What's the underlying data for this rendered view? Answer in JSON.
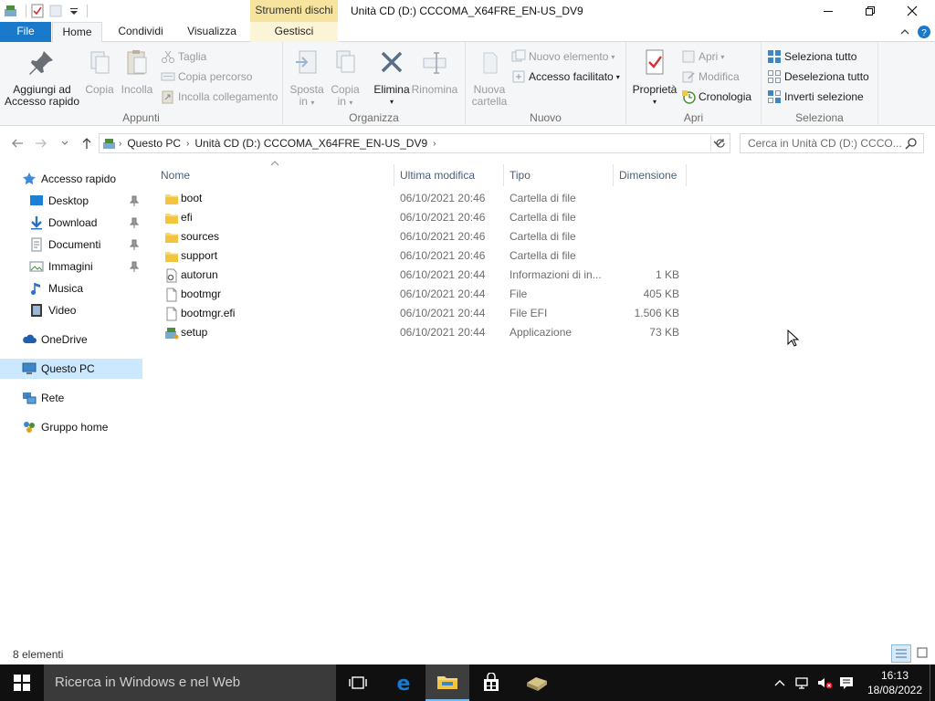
{
  "window": {
    "title": "Unità CD (D:) CCCOMA_X64FRE_EN-US_DV9",
    "context_label": "Strumenti dischi"
  },
  "tabs": {
    "file": "File",
    "home": "Home",
    "share": "Condividi",
    "view": "Visualizza",
    "manage": "Gestisci"
  },
  "ribbon": {
    "clipboard": {
      "pin_line1": "Aggiungi ad",
      "pin_line2": "Accesso rapido",
      "copy": "Copia",
      "paste": "Incolla",
      "cut": "Taglia",
      "copy_path": "Copia percorso",
      "paste_link": "Incolla collegamento",
      "label": "Appunti"
    },
    "organize": {
      "move_line1": "Sposta",
      "move_line2": "in",
      "copyto_line1": "Copia",
      "copyto_line2": "in",
      "delete": "Elimina",
      "rename": "Rinomina",
      "label": "Organizza"
    },
    "new": {
      "folder_line1": "Nuova",
      "folder_line2": "cartella",
      "new_item": "Nuovo elemento",
      "easy_access": "Accesso facilitato",
      "label": "Nuovo"
    },
    "open": {
      "properties": "Proprietà",
      "open": "Apri",
      "edit": "Modifica",
      "history": "Cronologia",
      "label": "Apri"
    },
    "select": {
      "select_all": "Seleziona tutto",
      "select_none": "Deseleziona tutto",
      "invert": "Inverti selezione",
      "label": "Seleziona"
    }
  },
  "address": {
    "crumbs": [
      "Questo PC",
      "Unità CD (D:) CCCOMA_X64FRE_EN-US_DV9"
    ],
    "search_placeholder": "Cerca in Unità CD (D:) CCCO..."
  },
  "nav": {
    "quick_access": "Accesso rapido",
    "items": [
      {
        "label": "Desktop",
        "icon": "desktop-icon"
      },
      {
        "label": "Download",
        "icon": "download-icon"
      },
      {
        "label": "Documenti",
        "icon": "documents-icon"
      },
      {
        "label": "Immagini",
        "icon": "pictures-icon"
      },
      {
        "label": "Musica",
        "icon": "music-icon"
      },
      {
        "label": "Video",
        "icon": "video-icon"
      }
    ],
    "onedrive": "OneDrive",
    "this_pc": "Questo PC",
    "network": "Rete",
    "homegroup": "Gruppo home"
  },
  "columns": {
    "name": "Nome",
    "modified": "Ultima modifica",
    "type": "Tipo",
    "size": "Dimensione"
  },
  "files": [
    {
      "name": "boot",
      "date": "06/10/2021 20:46",
      "type": "Cartella di file",
      "size": "",
      "icon": "folder"
    },
    {
      "name": "efi",
      "date": "06/10/2021 20:46",
      "type": "Cartella di file",
      "size": "",
      "icon": "folder"
    },
    {
      "name": "sources",
      "date": "06/10/2021 20:46",
      "type": "Cartella di file",
      "size": "",
      "icon": "folder"
    },
    {
      "name": "support",
      "date": "06/10/2021 20:46",
      "type": "Cartella di file",
      "size": "",
      "icon": "folder"
    },
    {
      "name": "autorun",
      "date": "06/10/2021 20:44",
      "type": "Informazioni di in...",
      "size": "1 KB",
      "icon": "settings-file"
    },
    {
      "name": "bootmgr",
      "date": "06/10/2021 20:44",
      "type": "File",
      "size": "405 KB",
      "icon": "file"
    },
    {
      "name": "bootmgr.efi",
      "date": "06/10/2021 20:44",
      "type": "File EFI",
      "size": "1.506 KB",
      "icon": "file"
    },
    {
      "name": "setup",
      "date": "06/10/2021 20:44",
      "type": "Applicazione",
      "size": "73 KB",
      "icon": "setup"
    }
  ],
  "status": {
    "count": "8 elementi"
  },
  "taskbar": {
    "search_placeholder": "Ricerca in Windows e nel Web",
    "time": "16:13",
    "date": "18/08/2022"
  },
  "colors": {
    "accent": "#1979ca",
    "selection": "#cce8ff",
    "context_tab": "#f6e39e",
    "folder": "#f8d775"
  }
}
